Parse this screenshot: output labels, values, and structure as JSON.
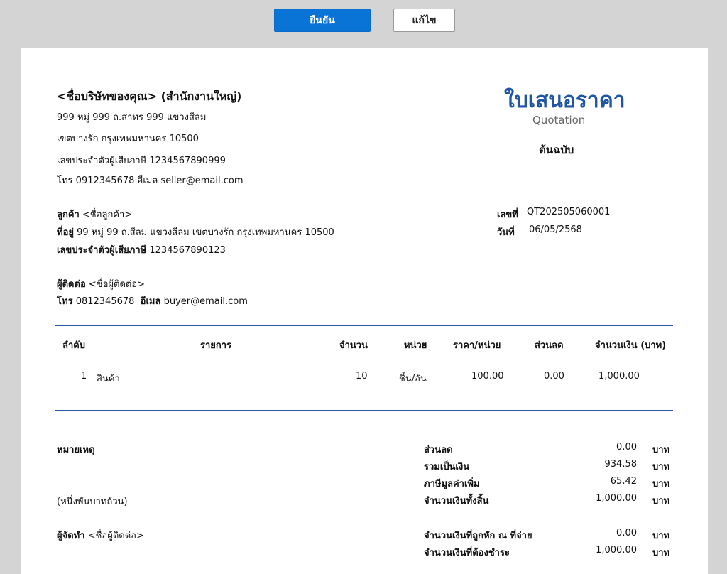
{
  "toolbar": {
    "confirm_label": "ยืนยัน",
    "edit_label": "แก้ไข"
  },
  "seller": {
    "name": "<ชื่อบริษัทของคุณ> (สำนักงานใหญ่)",
    "address1": "999 หมู่ 999 ถ.สาทร 999 แขวงสีลม",
    "address2": "เขตบางรัก  กรุงเทพมหานคร 10500",
    "tax_id": "เลขประจำตัวผู้เสียภาษี 1234567890999",
    "contact": "โทร 0912345678  อีเมล seller@email.com"
  },
  "document": {
    "title": "ใบเสนอราคา",
    "subtitle": "Quotation",
    "copy_label": "ต้นฉบับ",
    "number_label": "เลขที่",
    "number_value": "QT202505060001",
    "date_label": "วันที่",
    "date_value": "06/05/2568"
  },
  "customer": {
    "name_label": "ลูกค้า",
    "name_value": "<ชื่อลูกค้า>",
    "address_label": "ที่อยู่",
    "address_value": "99 หมู่ 99 ถ.สีลม แขวงสีลม เขตบางรัก กรุงเทพมหานคร 10500",
    "tax_label": "เลขประจำตัวผู้เสียภาษี",
    "tax_value": "1234567890123",
    "contact_label": "ผู้ติดต่อ",
    "contact_value": "<ชื่อผู้ติดต่อ>",
    "phone_label": "โทร",
    "phone_value": "0812345678",
    "email_label": "อีเมล",
    "email_value": "buyer@email.com"
  },
  "table": {
    "headers": [
      "ลำดับ",
      "รายการ",
      "จำนวน",
      "หน่วย",
      "ราคา/หน่วย",
      "ส่วนลด",
      "จำนวนเงิน (บาท)"
    ],
    "rows": [
      [
        "1",
        "สินค้า",
        "10",
        "ชิ้น/อัน",
        "100.00",
        "0.00",
        "1,000.00"
      ]
    ]
  },
  "notes": {
    "label": "หมายเหตุ",
    "amount_in_words": "(หนึ่งพันบาทถ้วน)",
    "prepared_by_label": "ผู้จัดทำ",
    "prepared_by_value": "<ชื่อผู้ติดต่อ>"
  },
  "summary": {
    "unit": "บาท",
    "rows": [
      {
        "label": "ส่วนลด",
        "value": "0.00"
      },
      {
        "label": "รวมเป็นเงิน",
        "value": "934.58"
      },
      {
        "label": "ภาษีมูลค่าเพิ่ม",
        "value": "65.42"
      },
      {
        "label": "จำนวนเงินทั้งสิ้น",
        "value": "1,000.00"
      },
      {
        "label": "จำนวนเงินที่ถูกหัก ณ ที่จ่าย",
        "value": "0.00"
      },
      {
        "label": "จำนวนเงินที่ต้องชำระ",
        "value": "1,000.00"
      }
    ]
  },
  "colors": {
    "accent": "#0a73d6",
    "title": "#1f55a3",
    "rule": "#2d56a5"
  }
}
